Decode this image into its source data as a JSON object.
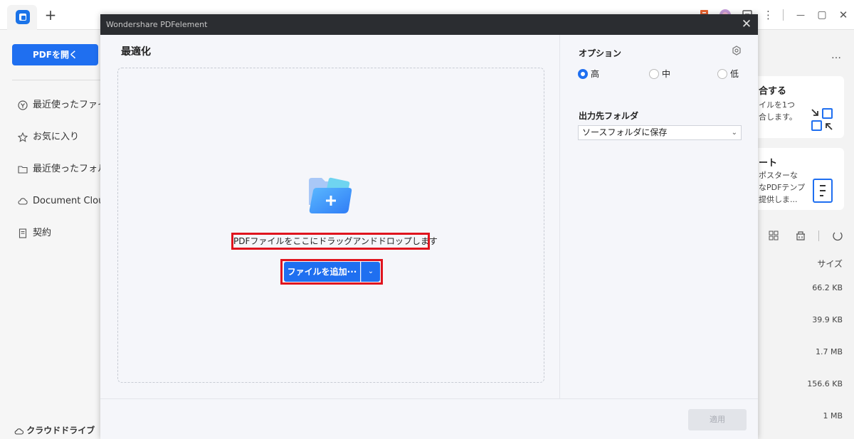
{
  "titlebar": {
    "new_tab": "+",
    "controls": {
      "more": "⋮",
      "minimize": "—",
      "maximize": "▢",
      "close": "✕"
    }
  },
  "sidebar": {
    "open_pdf": "PDFを開く",
    "items": [
      {
        "icon": "recent-icon",
        "label": "最近使ったファイル"
      },
      {
        "icon": "star-icon",
        "label": "お気に入り"
      },
      {
        "icon": "folder-icon",
        "label": "最近使ったフォルダ"
      },
      {
        "icon": "cloud-icon",
        "label": "Document Cloud"
      },
      {
        "icon": "contract-icon",
        "label": "契約"
      }
    ],
    "cloud_drive": "クラウドドライブ"
  },
  "background": {
    "more": "…",
    "card1": {
      "title": "合する",
      "desc1": "イルを1つ",
      "desc2": "合します。"
    },
    "card2": {
      "title": "ート",
      "desc1": "ポスターな",
      "desc2": "なPDFテンプ",
      "desc3": "提供しま..."
    },
    "size_header": "サイズ",
    "sizes": [
      "66.2 KB",
      "39.9 KB",
      "1.7 MB",
      "156.6 KB",
      "1 MB"
    ]
  },
  "dialog": {
    "title": "Wondershare PDFelement",
    "close": "✕",
    "heading": "最適化",
    "drop_text": "PDFファイルをここにドラッグアンドドロップします",
    "add_file": "ファイルを追加···",
    "add_file_dropdown": "⌄",
    "options_title": "オプション",
    "quality": [
      {
        "label": "高",
        "selected": true
      },
      {
        "label": "中",
        "selected": false
      },
      {
        "label": "低",
        "selected": false
      }
    ],
    "output_title": "出力先フォルダ",
    "output_value": "ソースフォルダに保存",
    "apply": "適用"
  },
  "colors": {
    "accent": "#1f6ff0",
    "highlight": "#e0141e",
    "dialog_title_bg": "#2b2d31"
  }
}
